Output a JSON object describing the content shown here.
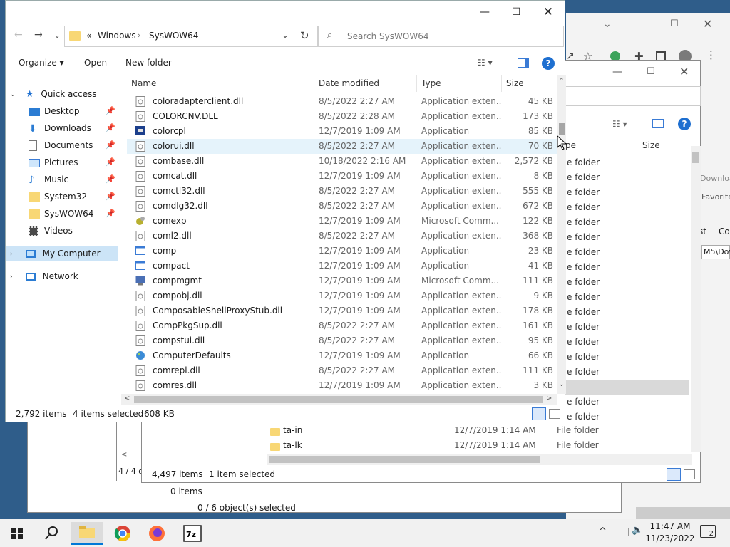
{
  "front": {
    "breadcrumb": {
      "prefix": "«",
      "parent": "Windows",
      "current": "SysWOW64"
    },
    "search_placeholder": "Search SysWOW64",
    "toolbar": {
      "organize": "Organize",
      "open": "Open",
      "new_folder": "New folder"
    },
    "nav": {
      "quick_access": "Quick access",
      "items": [
        "Desktop",
        "Downloads",
        "Documents",
        "Pictures",
        "Music",
        "System32",
        "SysWOW64",
        "Videos"
      ],
      "my_computer": "My Computer",
      "network": "Network"
    },
    "columns": {
      "name": "Name",
      "date": "Date modified",
      "type": "Type",
      "size": "Size"
    },
    "files": [
      {
        "name": "coloradapterclient.dll",
        "date": "8/5/2022 2:27 AM",
        "type": "Application exten...",
        "size": "45 KB",
        "icon": "dll"
      },
      {
        "name": "COLORCNV.DLL",
        "date": "8/5/2022 2:28 AM",
        "type": "Application exten...",
        "size": "173 KB",
        "icon": "dll"
      },
      {
        "name": "colorcpl",
        "date": "12/7/2019 1:09 AM",
        "type": "Application",
        "size": "85 KB",
        "icon": "color-app"
      },
      {
        "name": "colorui.dll",
        "date": "8/5/2022 2:27 AM",
        "type": "Application exten...",
        "size": "70 KB",
        "icon": "dll"
      },
      {
        "name": "combase.dll",
        "date": "10/18/2022 2:16 AM",
        "type": "Application exten...",
        "size": "2,572 KB",
        "icon": "dll"
      },
      {
        "name": "comcat.dll",
        "date": "12/7/2019 1:09 AM",
        "type": "Application exten...",
        "size": "8 KB",
        "icon": "dll"
      },
      {
        "name": "comctl32.dll",
        "date": "8/5/2022 2:27 AM",
        "type": "Application exten...",
        "size": "555 KB",
        "icon": "dll"
      },
      {
        "name": "comdlg32.dll",
        "date": "8/5/2022 2:27 AM",
        "type": "Application exten...",
        "size": "672 KB",
        "icon": "dll"
      },
      {
        "name": "comexp",
        "date": "12/7/2019 1:09 AM",
        "type": "Microsoft Comm...",
        "size": "122 KB",
        "icon": "msc"
      },
      {
        "name": "coml2.dll",
        "date": "8/5/2022 2:27 AM",
        "type": "Application exten...",
        "size": "368 KB",
        "icon": "dll"
      },
      {
        "name": "comp",
        "date": "12/7/2019 1:09 AM",
        "type": "Application",
        "size": "23 KB",
        "icon": "app"
      },
      {
        "name": "compact",
        "date": "12/7/2019 1:09 AM",
        "type": "Application",
        "size": "41 KB",
        "icon": "app"
      },
      {
        "name": "compmgmt",
        "date": "12/7/2019 1:09 AM",
        "type": "Microsoft Comm...",
        "size": "111 KB",
        "icon": "mgmt"
      },
      {
        "name": "compobj.dll",
        "date": "12/7/2019 1:09 AM",
        "type": "Application exten...",
        "size": "9 KB",
        "icon": "dll"
      },
      {
        "name": "ComposableShellProxyStub.dll",
        "date": "12/7/2019 1:09 AM",
        "type": "Application exten...",
        "size": "178 KB",
        "icon": "dll"
      },
      {
        "name": "CompPkgSup.dll",
        "date": "8/5/2022 2:27 AM",
        "type": "Application exten...",
        "size": "161 KB",
        "icon": "dll"
      },
      {
        "name": "compstui.dll",
        "date": "8/5/2022 2:27 AM",
        "type": "Application exten...",
        "size": "95 KB",
        "icon": "dll"
      },
      {
        "name": "ComputerDefaults",
        "date": "12/7/2019 1:09 AM",
        "type": "Application",
        "size": "66 KB",
        "icon": "defaults"
      },
      {
        "name": "comrepl.dll",
        "date": "8/5/2022 2:27 AM",
        "type": "Application exten...",
        "size": "111 KB",
        "icon": "dll"
      },
      {
        "name": "comres.dll",
        "date": "12/7/2019 1:09 AM",
        "type": "Application exten...",
        "size": "3 KB",
        "icon": "dll"
      }
    ],
    "status": {
      "count": "2,792 items",
      "selected": "4 items selected",
      "size": "608 KB"
    }
  },
  "middle": {
    "size_header": "Size",
    "type_header_partial": "pe",
    "folder_label": "e folder",
    "rows": [
      {
        "name": "ta-in",
        "date": "12/7/2019 1:14 AM",
        "type": "File folder"
      },
      {
        "name": "ta-lk",
        "date": "12/7/2019 1:14 AM",
        "type": "File folder"
      }
    ],
    "status": {
      "count": "4,497 items",
      "selected": "1 item selected"
    }
  },
  "small": {
    "count_partial": "4 / 4 o",
    "items": "0 items",
    "objects": "0 / 6 object(s) selected"
  },
  "browser": {
    "partial_download": "Downloa",
    "partial_favorites": "Favorite",
    "partial_st": "st",
    "partial_co": "Co",
    "partial_path": "M5\\Dov"
  },
  "taskbar": {
    "time": "11:47 AM",
    "date": "11/23/2022",
    "notif_count": "2"
  },
  "colors": {
    "accent": "#0078d7",
    "selection": "#cce4f7",
    "folder": "#f8d775",
    "help": "#1e6fd0"
  }
}
